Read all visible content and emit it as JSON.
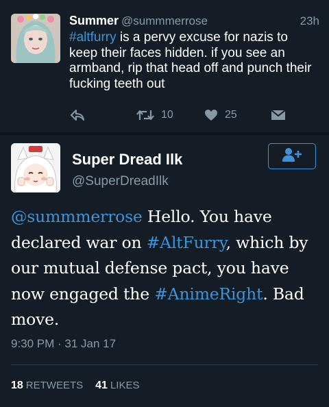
{
  "tweet1": {
    "display_name": "Summer",
    "handle": "@summmerrose",
    "time": "23h",
    "hashtag": "#altfurry",
    "text_rest": " is a pervy excuse for nazis to keep their faces hidden. if you see an armband, rip that head off and punch their fucking teeth out",
    "retweet_count": "10",
    "like_count": "25",
    "icons": [
      "reply-icon",
      "retweet-icon",
      "heart-icon",
      "direct-message-icon"
    ]
  },
  "tweet2": {
    "display_name": "Super Dread Ilk",
    "handle": "@SuperDreadIlk",
    "follow_icon": "add-user-icon",
    "segments": [
      {
        "text": "@summmerrose",
        "link": true
      },
      {
        "text": " Hello. You have declared war on ",
        "link": false
      },
      {
        "text": "#AltFurry",
        "link": true
      },
      {
        "text": ", which by our mutual defense pact, you have now engaged the ",
        "link": false
      },
      {
        "text": "#AnimeRight",
        "link": true
      },
      {
        "text": ". Bad move.",
        "link": false
      }
    ],
    "timestamp": "9:30 PM · 31 Jan 17",
    "retweets_count": "18",
    "retweets_label": "RETWEETS",
    "likes_count": "41",
    "likes_label": "LIKES"
  },
  "colors": {
    "background": "#141d26",
    "link": "#3b94d9",
    "secondary_text": "#8899a6"
  }
}
